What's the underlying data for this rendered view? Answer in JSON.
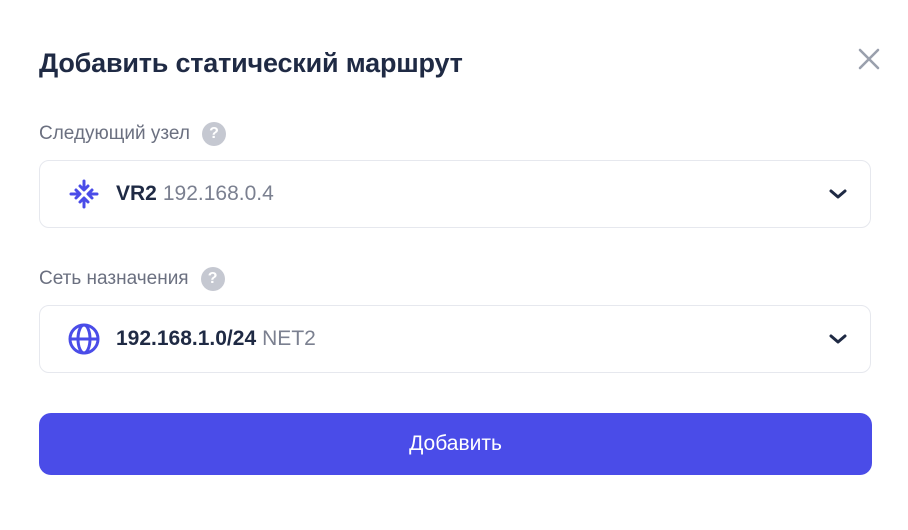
{
  "dialog": {
    "title": "Добавить статический маршрут",
    "close_icon": "close-icon"
  },
  "next_hop": {
    "label": "Следующий узел",
    "help": "?",
    "value_name": "VR2",
    "value_ip": "192.168.0.4",
    "icon": "router-icon"
  },
  "destination": {
    "label": "Сеть назначения",
    "help": "?",
    "value_cidr": "192.168.1.0/24",
    "value_name": "NET2",
    "icon": "globe-icon"
  },
  "submit_label": "Добавить",
  "colors": {
    "accent": "#4a4ce8",
    "title": "#1f2a44",
    "muted": "#7b8090",
    "border": "#e6e8ee"
  }
}
